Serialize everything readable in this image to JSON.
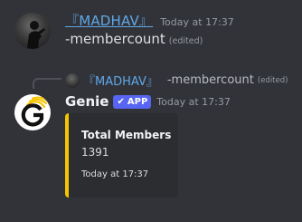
{
  "messages": [
    {
      "author": "『MADHAV』",
      "timestamp": "Today at 17:37",
      "content": "-membercount",
      "edited_label": "(edited)",
      "avatar": "silhouette-avatar"
    }
  ],
  "reply": {
    "author": "『MADHAV』",
    "content": "-membercount",
    "edited_label": "(edited)"
  },
  "bot_message": {
    "author": "Genie",
    "badge": "APP",
    "badge_icon": "checkmark-icon",
    "timestamp": "Today at 17:37",
    "avatar": "genie-logo",
    "embed": {
      "title": "Total Members",
      "value": "1391",
      "footer": "Today at 17:37",
      "accent_color": "#f7c400"
    }
  },
  "colors": {
    "background": "#323339",
    "username_link": "#5fa8e8",
    "badge": "#5865f2",
    "embed_bg": "#2b2d31"
  }
}
